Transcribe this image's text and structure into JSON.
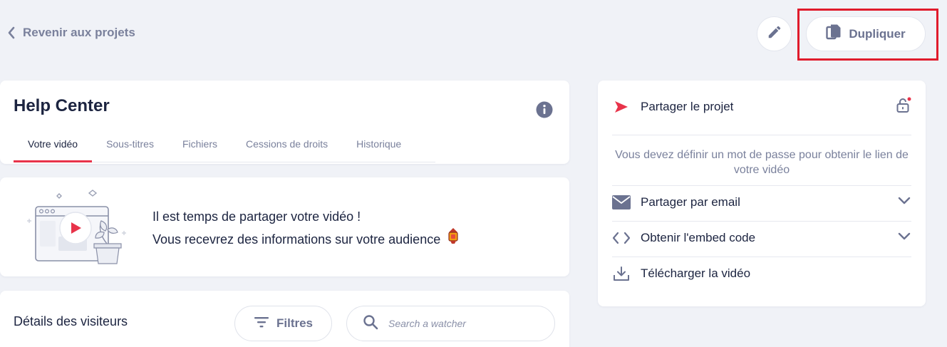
{
  "topbar": {
    "back_label": "Revenir aux projets",
    "duplicate_label": "Dupliquer"
  },
  "project": {
    "title": "Help Center",
    "tabs": [
      {
        "label": "Votre vidéo",
        "active": true
      },
      {
        "label": "Sous-titres",
        "active": false
      },
      {
        "label": "Fichiers",
        "active": false
      },
      {
        "label": "Cessions de droits",
        "active": false
      },
      {
        "label": "Historique",
        "active": false
      }
    ]
  },
  "banner": {
    "line1": "Il est temps de partager votre vidéo !",
    "line2": "Vous recevrez des informations sur votre audience"
  },
  "visitors": {
    "title": "Détails des visiteurs",
    "filters_label": "Filtres",
    "search_placeholder": "Search a watcher"
  },
  "share": {
    "share_project_label": "Partager le projet",
    "password_note": "Vous devez définir un mot de passe pour obtenir le lien de votre vidéo",
    "email_label": "Partager par email",
    "embed_label": "Obtenir l'embed code",
    "download_label": "Télécharger la vidéo"
  },
  "colors": {
    "accent": "#e8334a",
    "highlight_box": "#e01b2c",
    "muted_text": "#7a819c",
    "background": "#f0f2f7"
  },
  "icons": [
    "chevron-left-icon",
    "pencil-icon",
    "copy-icon",
    "info-icon",
    "send-icon",
    "lock-icon",
    "mail-icon",
    "code-icon",
    "download-icon",
    "chevron-down-icon",
    "filter-icon",
    "search-icon",
    "lantern-emoji"
  ]
}
